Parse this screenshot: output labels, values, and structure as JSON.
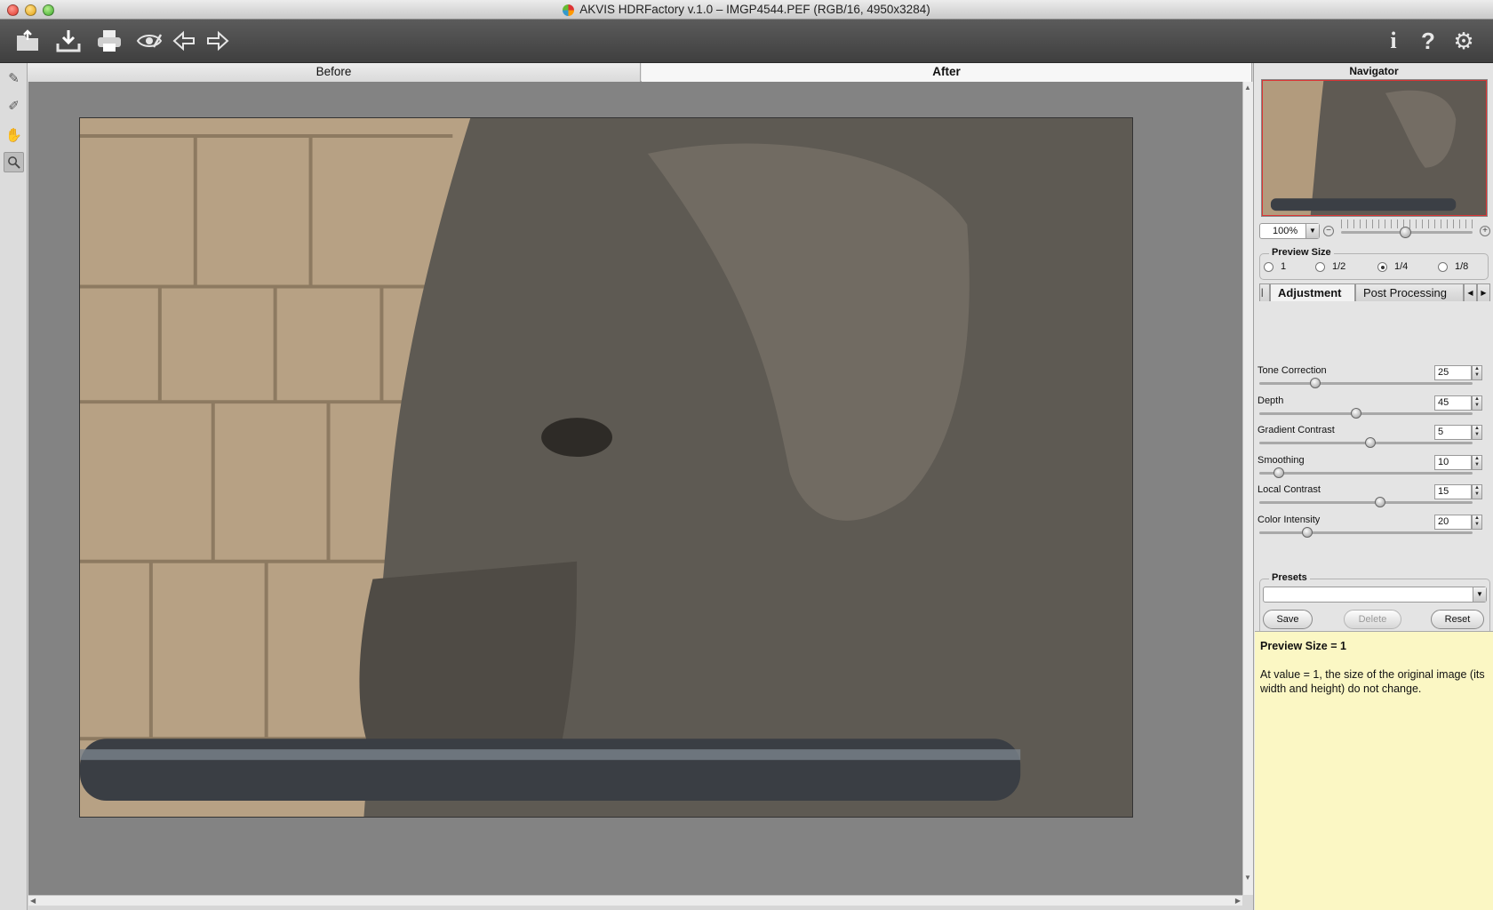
{
  "window": {
    "title": "AKVIS HDRFactory v.1.0 – IMGP4544.PEF (RGB/16, 4950x3284)"
  },
  "toolbar": {
    "left": [
      "open-icon",
      "save-icon",
      "print-icon",
      "preview-eye-icon",
      "undo-arrow-icon",
      "redo-arrow-icon"
    ],
    "right": [
      "info-icon",
      "help-icon",
      "settings-gear-icon"
    ]
  },
  "tools": [
    "brush-icon",
    "eraser-icon",
    "hand-icon",
    "zoom-icon"
  ],
  "view_tabs": {
    "before": "Before",
    "after": "After",
    "active": "After"
  },
  "navigator": {
    "title": "Navigator",
    "zoom": "100%",
    "zoom_level": 0.52
  },
  "preview_size": {
    "label": "Preview Size",
    "options": [
      "1",
      "1/2",
      "1/4",
      "1/8"
    ],
    "selected": "1/4"
  },
  "settings_tabs": {
    "adjustment": "Adjustment",
    "post": "Post Processing"
  },
  "params": [
    {
      "label": "Tone Correction",
      "value": "25",
      "level": 0.25
    },
    {
      "label": "Depth",
      "value": "45",
      "level": 0.45
    },
    {
      "label": "Gradient Contrast",
      "value": "5",
      "level": 0.52
    },
    {
      "label": "Smoothing",
      "value": "10",
      "level": 0.07
    },
    {
      "label": "Local Contrast",
      "value": "15",
      "level": 0.57
    },
    {
      "label": "Color Intensity",
      "value": "20",
      "level": 0.21
    }
  ],
  "presets": {
    "label": "Presets",
    "value": "",
    "save": "Save",
    "delete": "Delete",
    "reset": "Reset"
  },
  "help": {
    "title": "Preview Size = 1",
    "body": "At value = 1, the size of the original image (its width and height) do not change."
  },
  "colors": {
    "help_bg": "#fbf7c4",
    "canvas_bg": "#838383"
  }
}
